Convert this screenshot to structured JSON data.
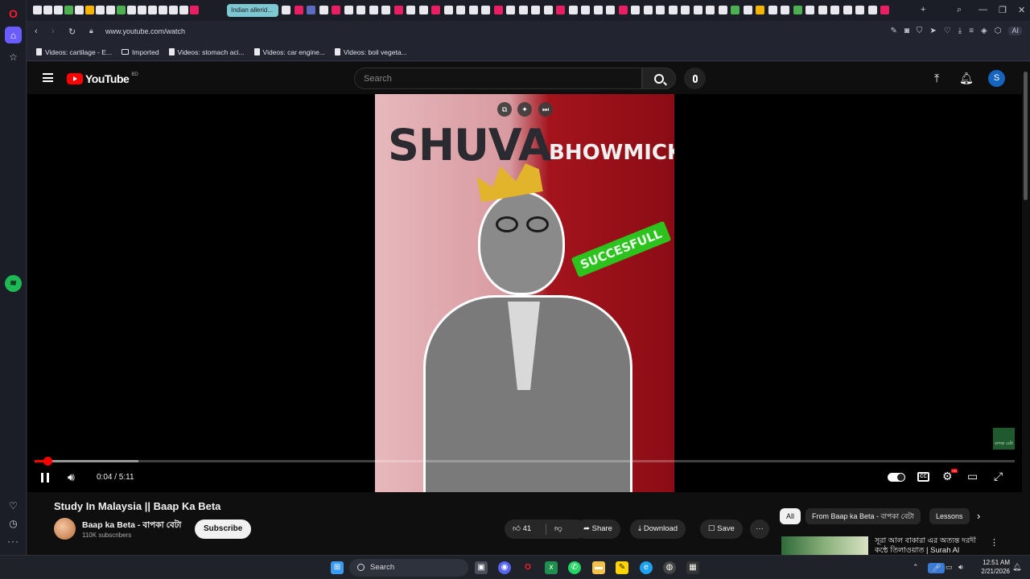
{
  "browser": {
    "active_tab_label": "Indian allerid...",
    "url": "www.youtube.com/watch",
    "ai_label": "AI",
    "bookmarks": [
      {
        "label": "Videos: cartilage - E..."
      },
      {
        "label": "Imported"
      },
      {
        "label": "Videos: stomach aci..."
      },
      {
        "label": "Videos: car engine..."
      },
      {
        "label": "Videos: boil vegeta..."
      }
    ]
  },
  "youtube": {
    "logo_text": "YouTube",
    "region": "BD",
    "search_placeholder": "Search",
    "avatar_letter": "S",
    "player": {
      "thumbnail_text_1": "SHUVA",
      "thumbnail_text_2": "BHOWMICK",
      "thumbnail_badge": "SUCCESFULL",
      "watermark_text": "বাপকা বেটা",
      "time_display": "0:04 / 5:11",
      "progress_played": 0.013,
      "progress_buffered": 0.106,
      "hd_badge": "HD"
    },
    "video": {
      "title": "Study In Malaysia || Baap Ka Beta",
      "channel_name": "Baap ka Beta - বাপকা বেটা",
      "subscribers": "110K subscribers",
      "subscribe_label": "Subscribe",
      "likes": "41",
      "share_label": "Share",
      "download_label": "Download",
      "save_label": "Save"
    },
    "chips": [
      "All",
      "From Baap ka Beta - বাপকা বেটা",
      "Lessons"
    ],
    "recommendation": {
      "title": "সূরা আল বাকারা এর অত্যন্ত দরদী কন্ঠে তিলাওয়াত | Surah Al"
    }
  },
  "taskbar": {
    "search_label": "Search",
    "time": "12:51 AM",
    "date": "2/21/2026"
  }
}
